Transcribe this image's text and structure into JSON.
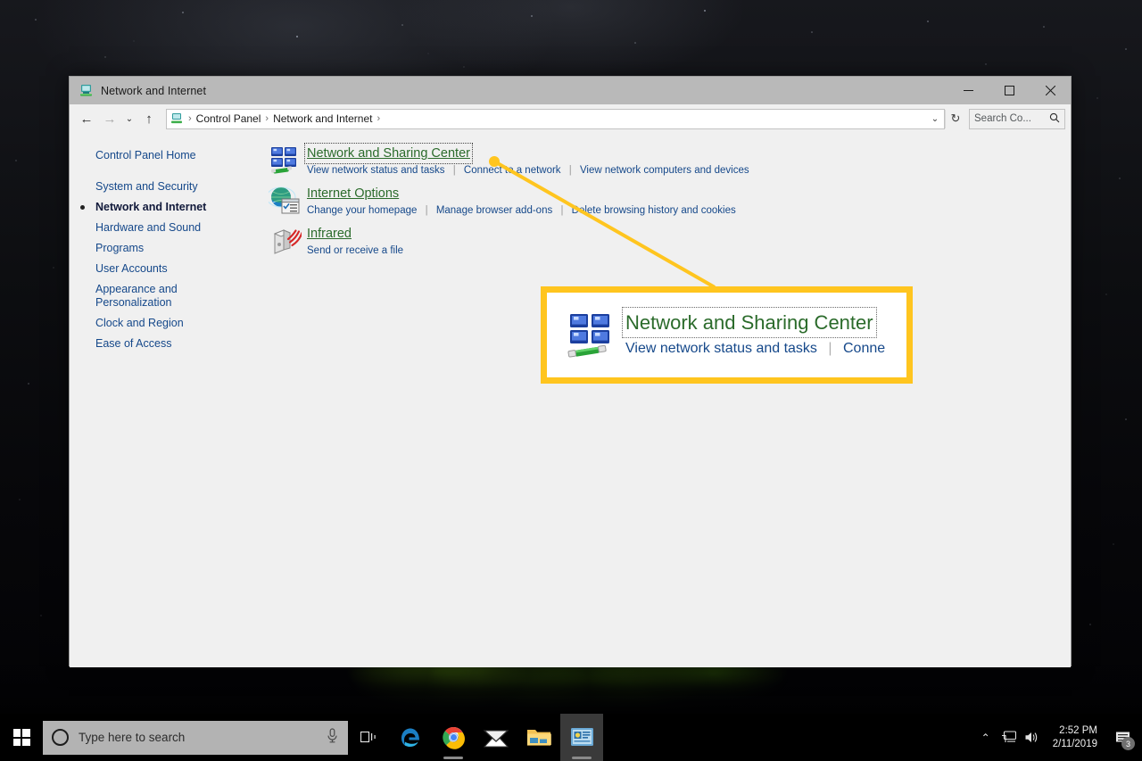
{
  "desktop": {
    "wallpaper_description": "night-sky-aurora-wallpaper"
  },
  "window": {
    "title": "Network and Internet",
    "title_icon": "network-folder-icon",
    "controls": {
      "minimize": "—",
      "maximize": "☐",
      "close": "✕"
    },
    "nav": {
      "back": "←",
      "forward": "→",
      "recent": "⌄",
      "up": "↑",
      "address_icon": "control-panel-icon",
      "breadcrumbs": [
        "Control Panel",
        "Network and Internet"
      ],
      "separator": "›",
      "dropdown": "⌄",
      "refresh": "↻",
      "search_placeholder": "Search Co...",
      "search_icon": "search-icon"
    }
  },
  "sidebar": {
    "items": [
      {
        "label": "Control Panel Home",
        "current": false
      },
      {
        "label": "System and Security",
        "current": false
      },
      {
        "label": "Network and Internet",
        "current": true
      },
      {
        "label": "Hardware and Sound",
        "current": false
      },
      {
        "label": "Programs",
        "current": false
      },
      {
        "label": "User Accounts",
        "current": false
      },
      {
        "label": "Appearance and\nPersonalization",
        "current": false
      },
      {
        "label": "Clock and Region",
        "current": false
      },
      {
        "label": "Ease of Access",
        "current": false
      }
    ]
  },
  "main": {
    "categories": [
      {
        "title": "Network and Sharing Center",
        "icon": "network-sharing-center-icon",
        "focused": true,
        "links": [
          "View network status and tasks",
          "Connect to a network",
          "View network computers and devices"
        ]
      },
      {
        "title": "Internet Options",
        "icon": "internet-options-icon",
        "focused": false,
        "links": [
          "Change your homepage",
          "Manage browser add-ons",
          "Delete browsing history and cookies"
        ]
      },
      {
        "title": "Infrared",
        "icon": "infrared-icon",
        "focused": false,
        "links": [
          "Send or receive a file"
        ]
      }
    ]
  },
  "callout": {
    "accent_color": "#ffc51f",
    "title": "Network and Sharing Center",
    "icon": "network-sharing-center-icon",
    "links": [
      "View network status and tasks",
      "Conne"
    ],
    "separator": "|"
  },
  "taskbar": {
    "start_icon": "windows-logo-icon",
    "search": {
      "placeholder": "Type here to search",
      "cortana_icon": "cortana-circle-icon",
      "mic_icon": "microphone-icon"
    },
    "task_view_icon": "task-view-icon",
    "apps": [
      {
        "name": "edge",
        "icon": "edge-icon",
        "active": false,
        "running": false
      },
      {
        "name": "chrome",
        "icon": "chrome-icon",
        "active": false,
        "running": true
      },
      {
        "name": "mail",
        "icon": "mail-icon",
        "active": false,
        "running": false
      },
      {
        "name": "file-explorer",
        "icon": "file-explorer-icon",
        "active": false,
        "running": false
      },
      {
        "name": "control-panel",
        "icon": "control-panel-icon",
        "active": true,
        "running": true
      }
    ],
    "tray": {
      "chevron": "⌃",
      "network_icon": "network-monitor-icon",
      "volume_icon": "speaker-icon",
      "time": "2:52 PM",
      "date": "2/11/2019",
      "notification_icon": "action-center-icon",
      "notification_count": "3"
    }
  }
}
